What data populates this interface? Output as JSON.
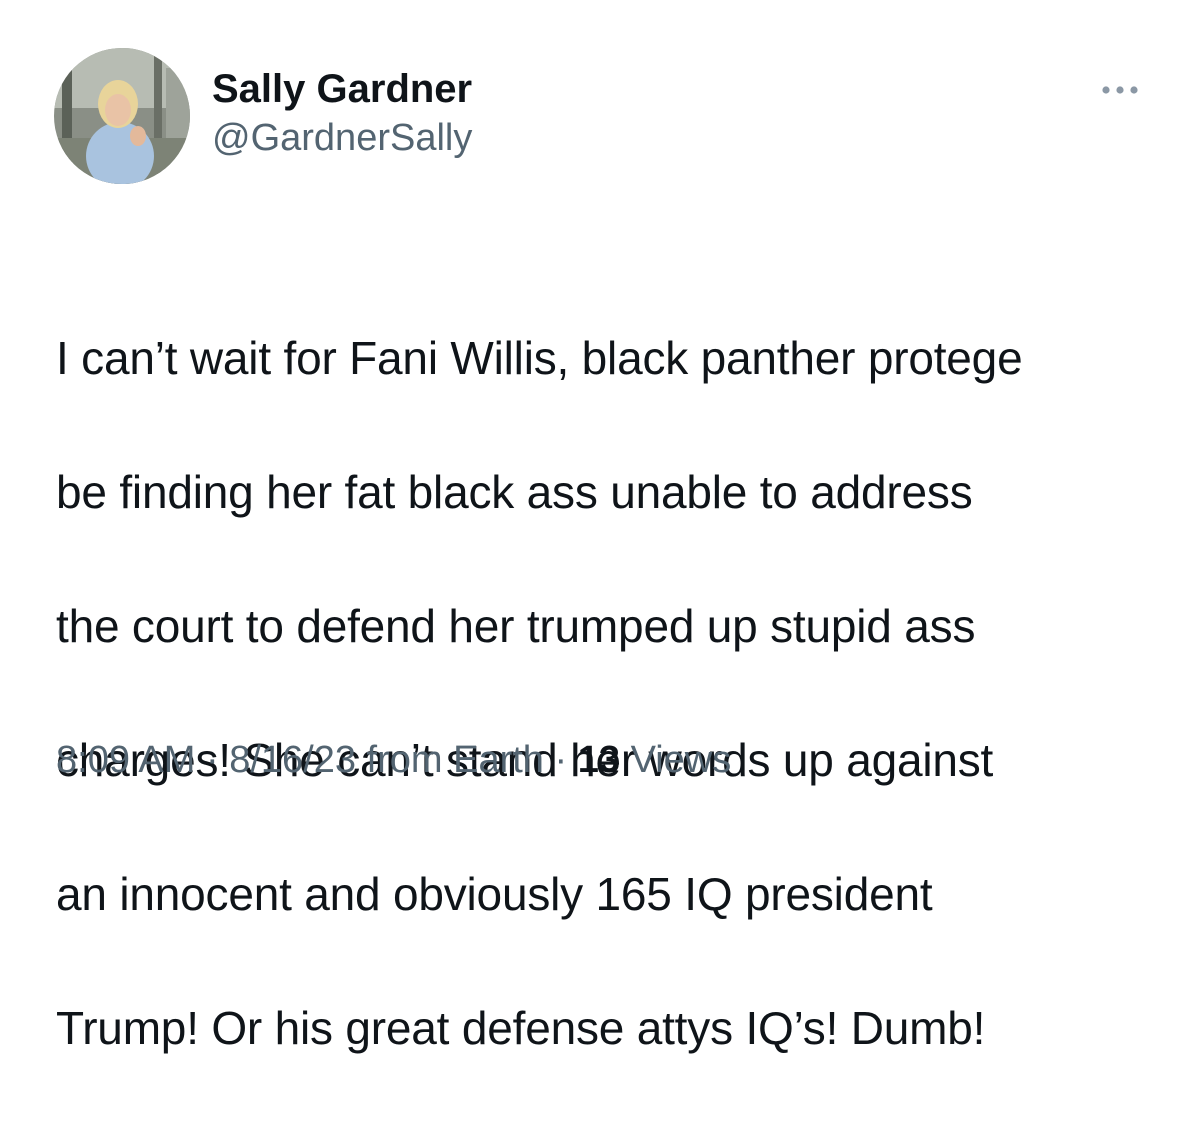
{
  "tweet": {
    "author": {
      "display_name": "Sally Gardner",
      "handle": "@GardnerSally",
      "avatar": "profile-photo"
    },
    "more_icon": "more-horizontal-icon",
    "text_lines": [
      "I can’t wait for Fani Willis, black panther protege",
      "be finding her fat black ass unable to address",
      "the court to defend her trumped up stupid ass",
      "charges! She can’t stand her words up against",
      "an innocent and obviously 165 IQ president",
      "Trump! Or his great defense attys IQ’s! Dumb!"
    ],
    "meta": {
      "time": "8:09 AM",
      "separator": " · ",
      "date_source": "8/16/23 from Earth",
      "views_count": "13",
      "views_label": "Views"
    }
  },
  "colors": {
    "text_primary": "#0f1419",
    "text_secondary": "#536471",
    "background": "#ffffff"
  }
}
